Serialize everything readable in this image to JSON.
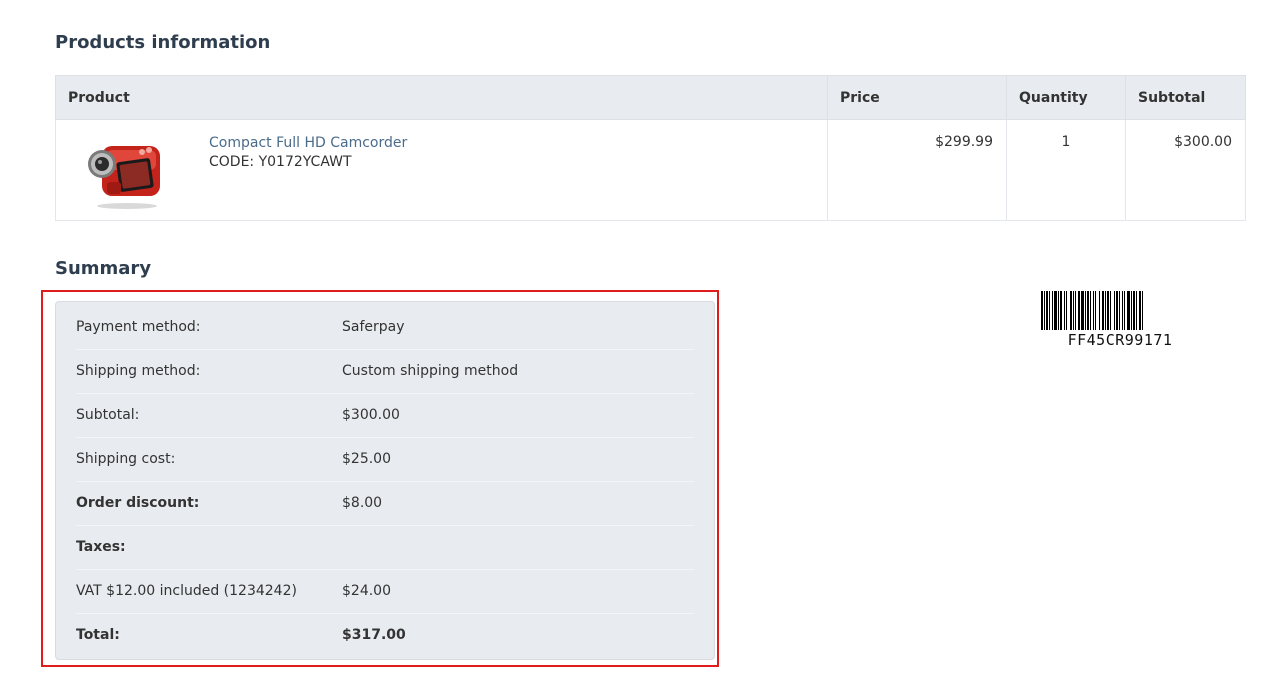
{
  "products": {
    "title": "Products information",
    "headers": {
      "product": "Product",
      "price": "Price",
      "quantity": "Quantity",
      "subtotal": "Subtotal"
    },
    "items": [
      {
        "name": "Compact Full HD Camcorder",
        "code": "CODE: Y0172YCAWT",
        "price": "$299.99",
        "quantity": "1",
        "subtotal": "$300.00",
        "image_icon": "red-camcorder-image"
      }
    ]
  },
  "summary": {
    "title": "Summary",
    "rows": [
      {
        "label": "Payment method:",
        "value": "Saferpay"
      },
      {
        "label": "Shipping method:",
        "value": "Custom shipping method"
      },
      {
        "label": "Subtotal:",
        "value": "$300.00"
      },
      {
        "label": "Shipping cost:",
        "value": "$25.00"
      },
      {
        "label": "Order discount:",
        "value": "$8.00"
      },
      {
        "label": "Taxes:",
        "value": ""
      },
      {
        "label": "VAT $12.00 included (1234242)",
        "value": "$24.00"
      },
      {
        "label": "Total:",
        "value": "$317.00"
      }
    ],
    "highlight_color": "#e01b1b"
  },
  "barcode": {
    "text": "FF45CR99171"
  },
  "colors": {
    "heading": "#2f3e4e",
    "link": "#4a6b8a",
    "panel_bg": "#e8ebef"
  }
}
